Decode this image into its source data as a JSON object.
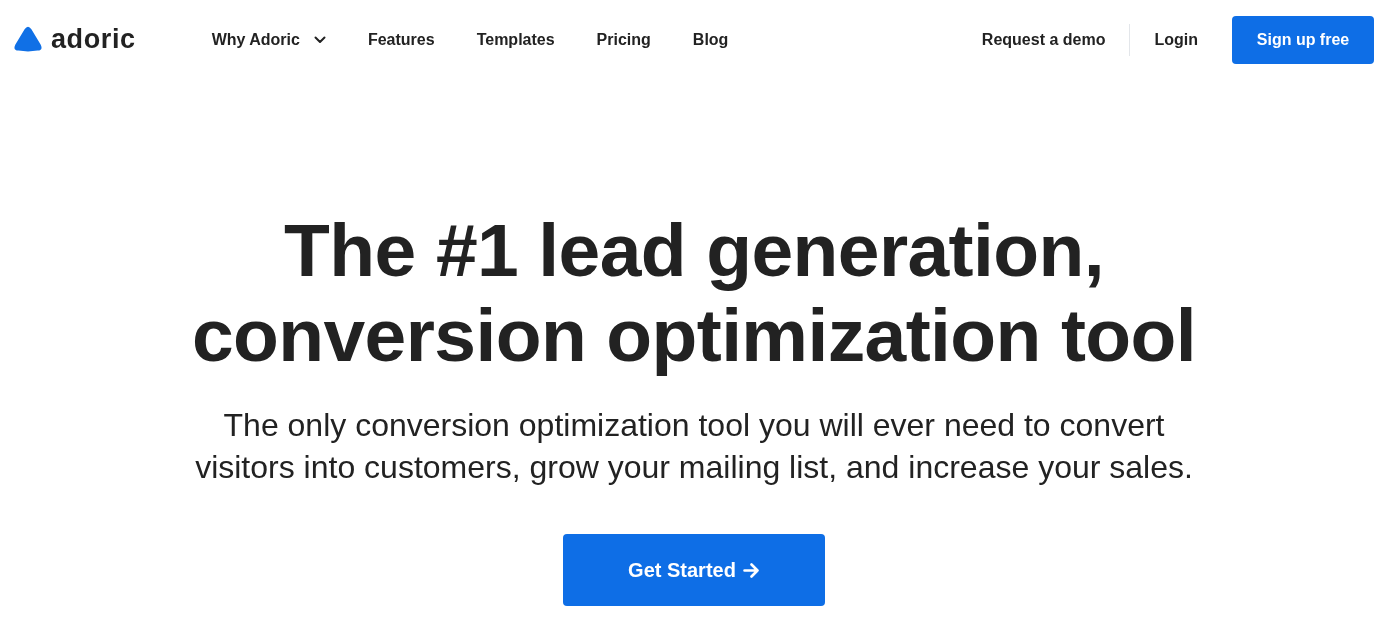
{
  "header": {
    "logo": {
      "text": "adoric"
    },
    "nav": [
      {
        "label": "Why Adoric",
        "kind": "dropdown"
      },
      {
        "label": "Features",
        "kind": "link"
      },
      {
        "label": "Templates",
        "kind": "link"
      },
      {
        "label": "Pricing",
        "kind": "link"
      },
      {
        "label": "Blog",
        "kind": "link"
      }
    ],
    "actions": [
      {
        "label": "Request a demo",
        "kind": "link"
      },
      {
        "label": "Login",
        "kind": "link"
      },
      {
        "label": "Sign up free",
        "kind": "button"
      }
    ]
  },
  "hero": {
    "title_lines": [
      "The #1 lead generation,",
      "conversion optimization tool"
    ],
    "subtitle_lines": [
      "The only conversion optimization tool you will ever need to convert",
      "visitors into customers, grow your mailing list, and increase your sales."
    ],
    "cta": {
      "label": "Get Started"
    }
  }
}
